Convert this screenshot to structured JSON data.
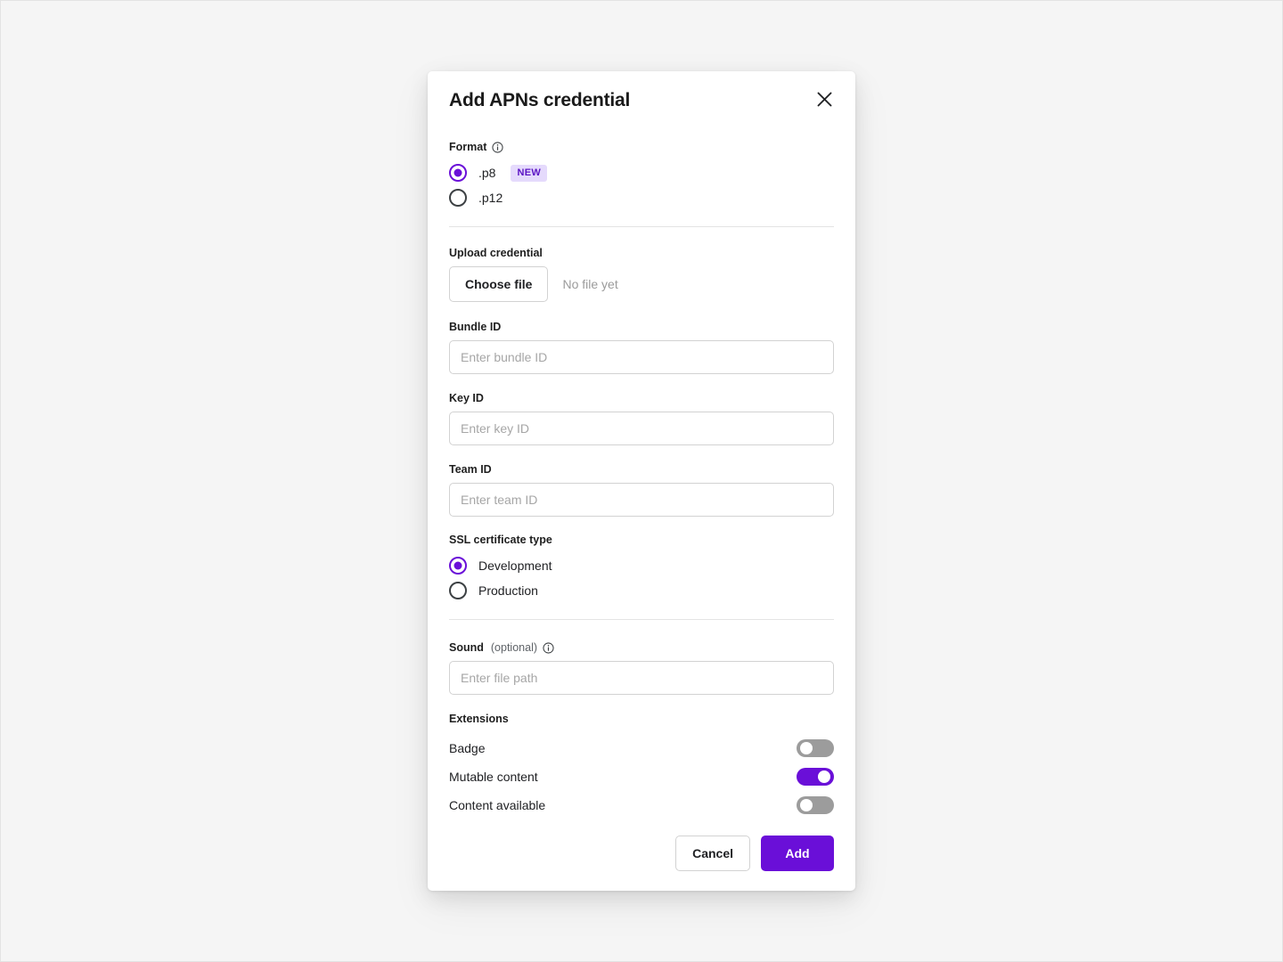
{
  "dialog": {
    "title": "Add APNs credential",
    "close_icon": "close-icon"
  },
  "format_section": {
    "label": "Format",
    "info_icon": "info-icon",
    "options": [
      {
        "label": ".p8",
        "selected": true,
        "badge": "NEW"
      },
      {
        "label": ".p12",
        "selected": false,
        "badge": ""
      }
    ]
  },
  "upload_section": {
    "label": "Upload credential",
    "choose_file_label": "Choose file",
    "file_status": "No file yet"
  },
  "bundle_id": {
    "label": "Bundle ID",
    "placeholder": "Enter bundle ID",
    "value": ""
  },
  "key_id": {
    "label": "Key ID",
    "placeholder": "Enter key ID",
    "value": ""
  },
  "team_id": {
    "label": "Team ID",
    "placeholder": "Enter team ID",
    "value": ""
  },
  "ssl_section": {
    "label": "SSL certificate type",
    "options": [
      {
        "label": "Development",
        "selected": true
      },
      {
        "label": "Production",
        "selected": false
      }
    ]
  },
  "sound_section": {
    "label": "Sound",
    "optional_text": "(optional)",
    "info_icon": "info-icon",
    "placeholder": "Enter file path",
    "value": ""
  },
  "extensions": {
    "label": "Extensions",
    "items": [
      {
        "label": "Badge",
        "on": false
      },
      {
        "label": "Mutable content",
        "on": true
      },
      {
        "label": "Content available",
        "on": false
      }
    ]
  },
  "footer": {
    "cancel_label": "Cancel",
    "add_label": "Add"
  },
  "colors": {
    "accent": "#6a0fd8",
    "badge_bg": "#e5dafc",
    "badge_text": "#5b13c4",
    "page_bg": "#f5f5f5",
    "toggle_off": "#9c9c9c",
    "border": "#d2d2d2"
  }
}
